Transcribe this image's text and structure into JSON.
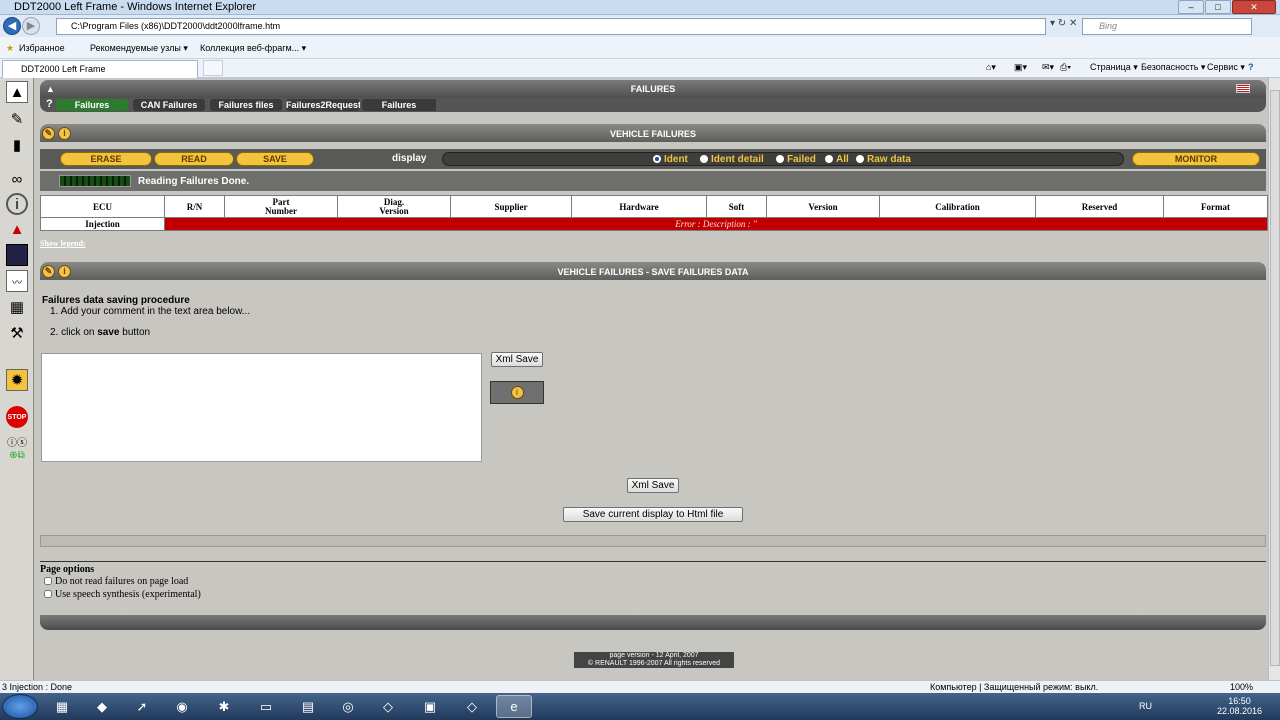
{
  "window": {
    "title": "DDT2000 Left Frame - Windows Internet Explorer",
    "close": "✕",
    "min": "–",
    "max": "□"
  },
  "address": {
    "url": "C:\\Program Files (x86)\\DDT2000\\ddt2000lframe.htm",
    "search_placeholder": "Bing"
  },
  "favorites": {
    "label": "Избранное",
    "item1": "Рекомендуемые узлы ▾",
    "item2": "Коллекция веб-фрагм... ▾"
  },
  "tab": {
    "label": "DDT2000 Left Frame"
  },
  "commands": {
    "page": "Страница ▾",
    "security": "Безопасность ▾",
    "service": "Сервис ▾",
    "help": "?"
  },
  "app": {
    "top_title": "FAILURES",
    "tabs": [
      "Failures",
      "CAN Failures",
      "Failures files",
      "Failures2Request",
      "Failures Simulato"
    ],
    "vf_title": "VEHICLE FAILURES",
    "buttons": {
      "erase": "ERASE",
      "read": "READ",
      "save": "SAVE",
      "monitor": "MONITOR"
    },
    "display_label": "display",
    "display_options": [
      "Ident",
      "Ident detail",
      "Failed",
      "All",
      "Raw data"
    ],
    "display_selected": "Ident",
    "status_text": "Reading Failures Done.",
    "table": {
      "headers": [
        "ECU",
        "R/N",
        "Part\nNumber",
        "Diag.\nVersion",
        "Supplier",
        "Hardware",
        "Soft",
        "Version",
        "Calibration",
        "Reserved",
        "Format"
      ],
      "row": {
        "ecu": "Injection",
        "error": "Error : Description : ''"
      }
    },
    "show_legend": "Show legend:",
    "save_title": "VEHICLE FAILURES - SAVE FAILURES DATA",
    "procedure": {
      "title": "Failures data saving procedure",
      "step1": "1.   Add your comment in the text area below...",
      "step2_pre": "2.   click on ",
      "step2_bold": "save",
      "step2_post": " button"
    },
    "xml_save": "Xml Save",
    "xml_save2": "Xml Save",
    "save_html": "Save current display to Html file",
    "page_options": {
      "title": "Page options",
      "opt1": "Do not read failures on page load",
      "opt2": "Use speech synthesis (experimental)"
    },
    "footer": {
      "line1": "page version - 12 April, 2007",
      "line2": "© RENAULT 1996-2007 All rights reserved"
    }
  },
  "statusbar": {
    "left": "3 Injection : Done",
    "zone": "Компьютер | Защищенный режим: выкл.",
    "zoom": "100%"
  },
  "taskbar": {
    "lang": "RU",
    "time": "16:50",
    "date": "22.08.2016"
  }
}
